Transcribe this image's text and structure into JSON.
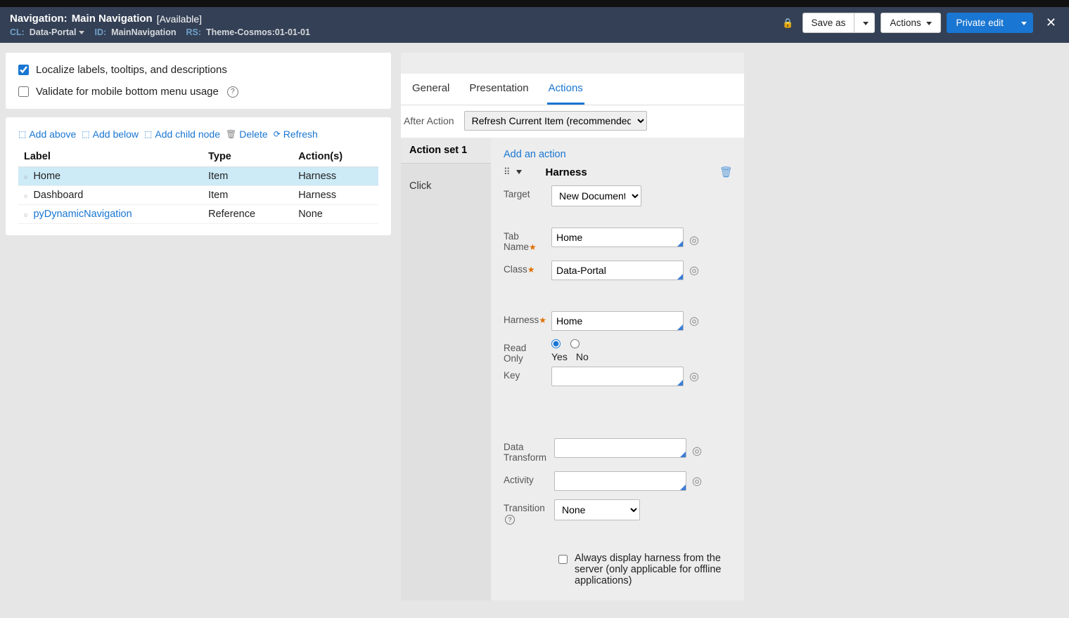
{
  "header": {
    "title_prefix": "Navigation:",
    "title_name": "Main Navigation",
    "status": "[Available]",
    "cl_label": "CL:",
    "cl_value": "Data-Portal",
    "id_label": "ID:",
    "id_value": "MainNavigation",
    "rs_label": "RS:",
    "rs_value": "Theme-Cosmos:01-01-01",
    "save_as": "Save as",
    "actions": "Actions",
    "private_edit": "Private edit"
  },
  "options": {
    "localize": "Localize labels, tooltips, and descriptions",
    "validate_mobile": "Validate for mobile bottom menu usage"
  },
  "toolbar": {
    "add_above": "Add above",
    "add_below": "Add below",
    "add_child": "Add child node",
    "delete": "Delete",
    "refresh": "Refresh"
  },
  "nav_table": {
    "headers": {
      "label": "Label",
      "type": "Type",
      "actions": "Action(s)"
    },
    "rows": [
      {
        "label": "Home",
        "type": "Item",
        "actions": "Harness",
        "selected": true,
        "link": false
      },
      {
        "label": "Dashboard",
        "type": "Item",
        "actions": "Harness",
        "selected": false,
        "link": false
      },
      {
        "label": "pyDynamicNavigation",
        "type": "Reference",
        "actions": "None",
        "selected": false,
        "link": true
      }
    ]
  },
  "tabs": {
    "general": "General",
    "presentation": "Presentation",
    "actions": "Actions"
  },
  "after_action": {
    "label": "After Action",
    "value": "Refresh Current Item (recommended)"
  },
  "action_set": {
    "title": "Action set 1",
    "event": "Click"
  },
  "form": {
    "add_action": "Add an action",
    "action_name": "Harness",
    "target_label": "Target",
    "target_value": "New Document",
    "tab_name_label": "Tab Name",
    "tab_name_value": "Home",
    "class_label": "Class",
    "class_value": "Data-Portal",
    "harness_label": "Harness",
    "harness_value": "Home",
    "read_only_label": "Read Only",
    "yes": "Yes",
    "no": "No",
    "key_label": "Key",
    "key_value": "",
    "data_transform_label": "Data Transform",
    "data_transform_value": "",
    "activity_label": "Activity",
    "activity_value": "",
    "transition_label": "Transition",
    "transition_value": "None",
    "offline_checkbox": "Always display harness from the server (only applicable for offline applications)"
  }
}
